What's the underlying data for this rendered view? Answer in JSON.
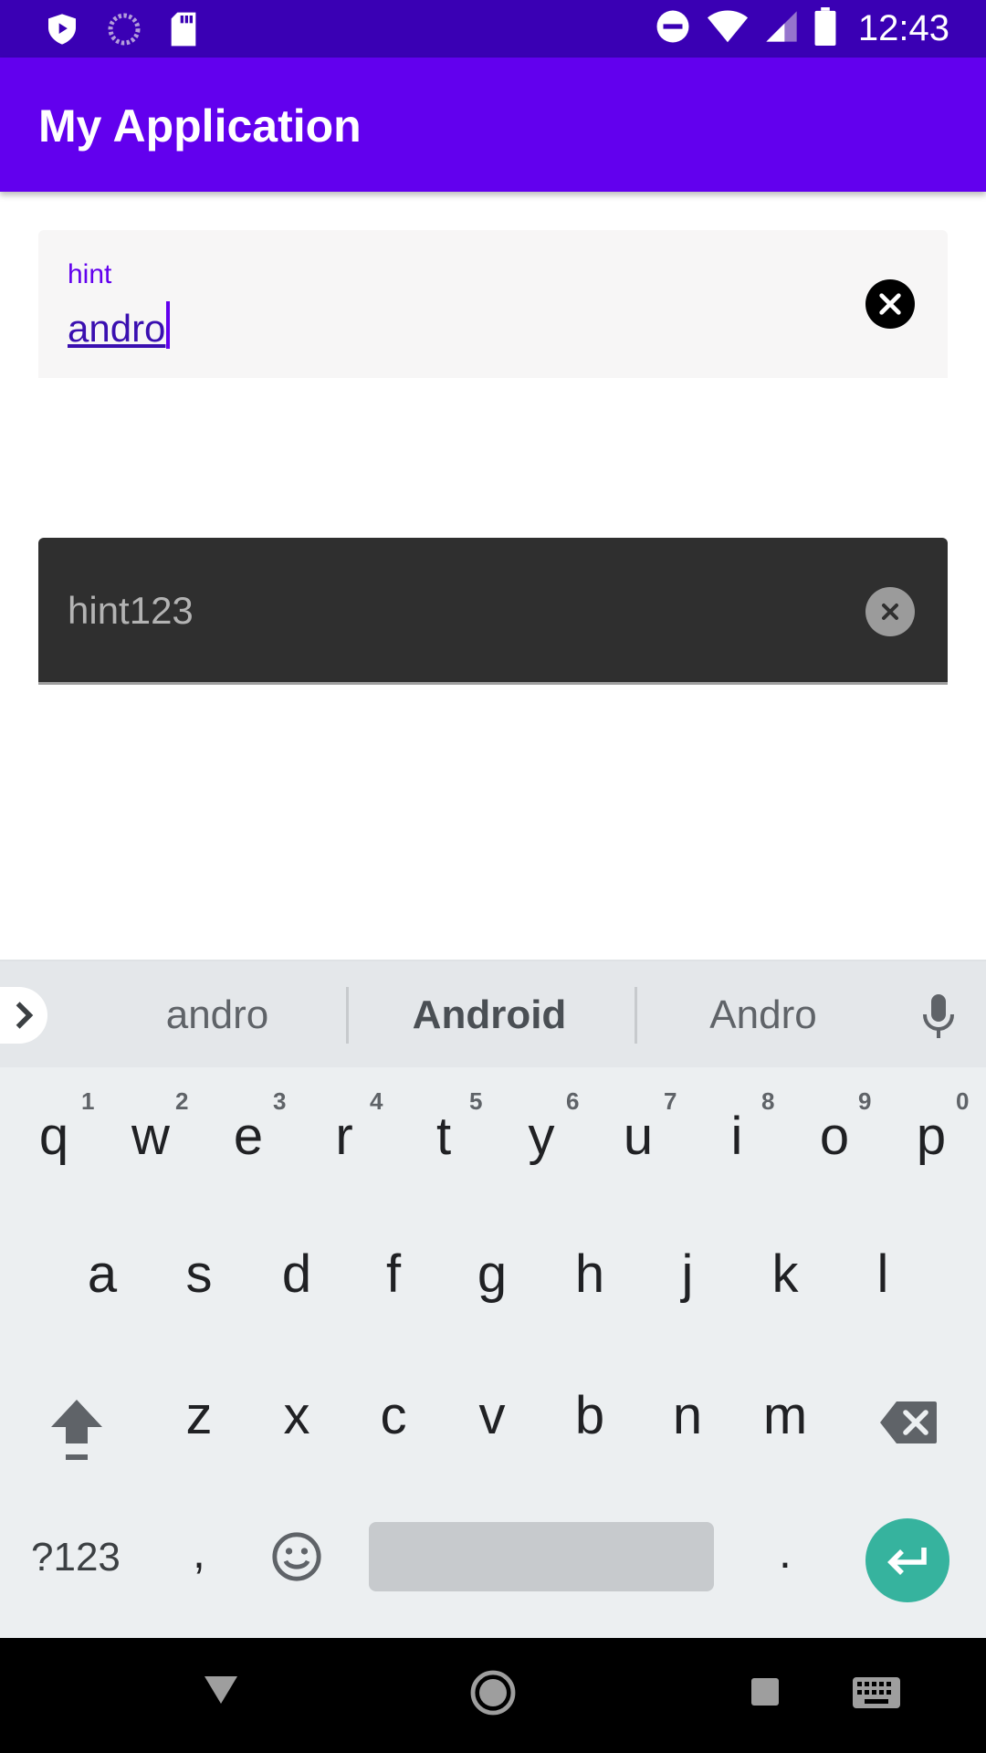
{
  "status_bar": {
    "time": "12:43",
    "left_icons": [
      "play-protect-icon",
      "sync-icon",
      "sd-card-icon"
    ],
    "right_icons": [
      "do-not-disturb-icon",
      "wifi-icon",
      "signal-icon",
      "battery-icon"
    ]
  },
  "app_bar": {
    "title": "My Application"
  },
  "field1": {
    "label": "hint",
    "value": "andro"
  },
  "field2": {
    "hint": "hint123"
  },
  "keyboard": {
    "suggestions": [
      "andro",
      "Android",
      "Andro"
    ],
    "row1": [
      "q",
      "w",
      "e",
      "r",
      "t",
      "y",
      "u",
      "i",
      "o",
      "p"
    ],
    "row1_hints": [
      "1",
      "2",
      "3",
      "4",
      "5",
      "6",
      "7",
      "8",
      "9",
      "0"
    ],
    "row2": [
      "a",
      "s",
      "d",
      "f",
      "g",
      "h",
      "j",
      "k",
      "l"
    ],
    "row3": [
      "z",
      "x",
      "c",
      "v",
      "b",
      "n",
      "m"
    ],
    "symbols_label": "?123",
    "comma": ",",
    "period": "."
  },
  "colors": {
    "status_bar": "#3a00b4",
    "primary": "#6200ee",
    "enter_key": "#36b39e",
    "field2_bg": "#2f2f2f"
  }
}
